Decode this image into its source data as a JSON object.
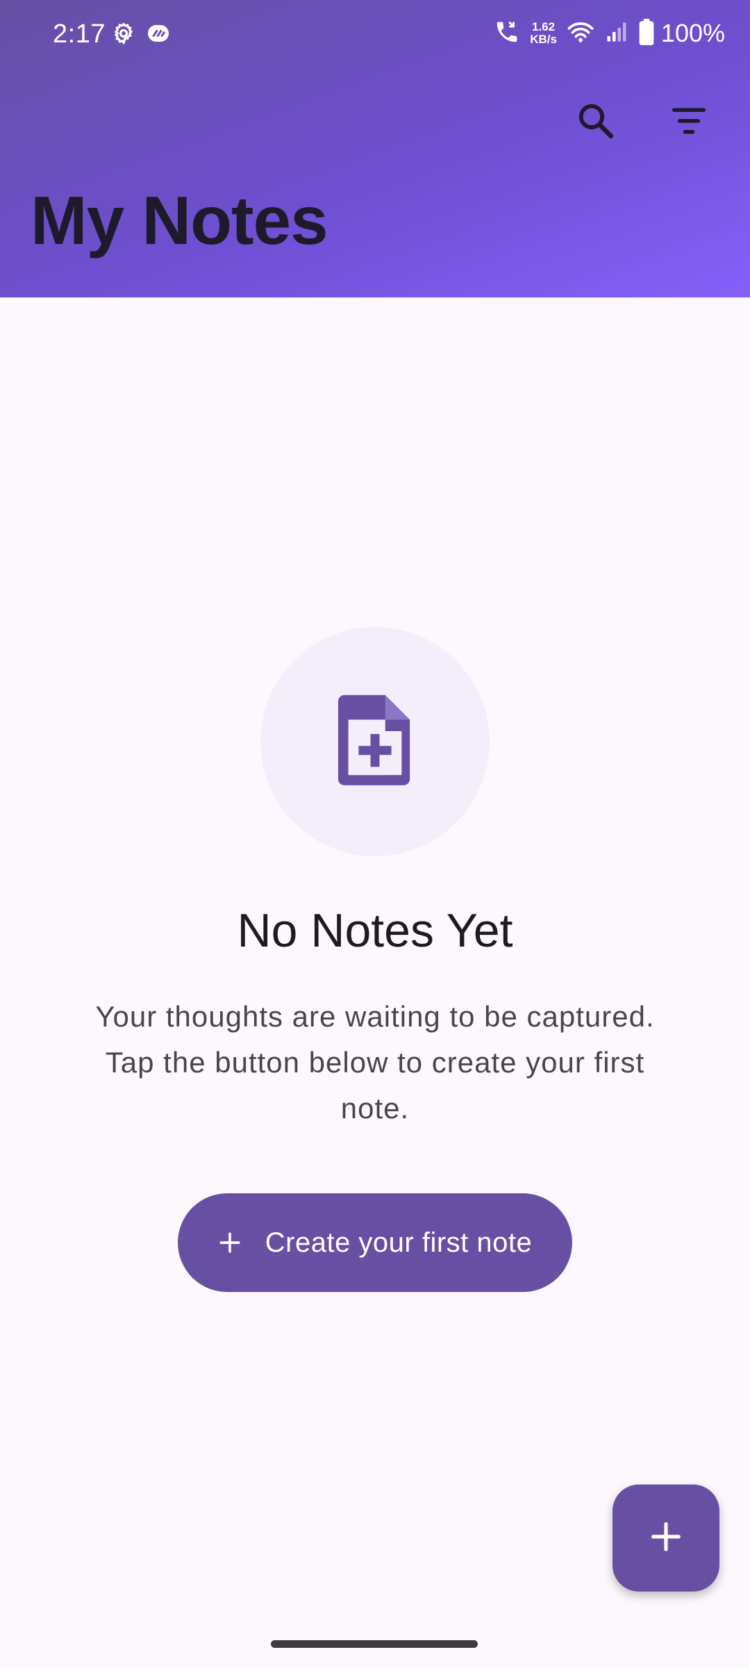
{
  "status_bar": {
    "time": "2:17",
    "net_speed_value": "1.62",
    "net_speed_unit": "KB/s",
    "battery_percent": "100%"
  },
  "header": {
    "title": "My Notes",
    "actions": [
      {
        "icon": "search-icon"
      },
      {
        "icon": "filter-icon"
      }
    ]
  },
  "empty_state": {
    "icon": "note-add-icon",
    "title": "No Notes Yet",
    "description": "Your thoughts are waiting to be captured. Tap the button below to create your first note.",
    "button_label": "Create your first note"
  },
  "fab": {
    "icon": "plus-icon"
  },
  "colors": {
    "primary": "#6750a4",
    "header_gradient_start": "#6650a4",
    "header_gradient_end": "#8660fa",
    "background": "#fdf8fd"
  }
}
